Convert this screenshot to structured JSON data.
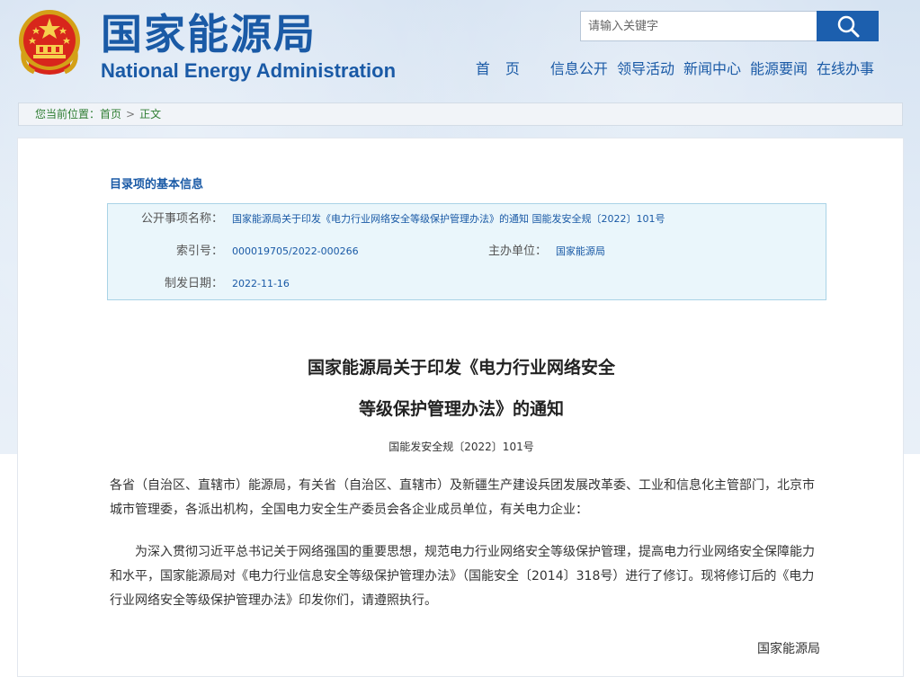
{
  "header": {
    "title_cn": "国家能源局",
    "title_en": "National Energy Administration",
    "search_placeholder": "请输入关键字",
    "emblem": "national-emblem"
  },
  "nav": {
    "items": [
      {
        "label": "首 页"
      },
      {
        "label": "信息公开"
      },
      {
        "label": "领导活动"
      },
      {
        "label": "新闻中心"
      },
      {
        "label": "能源要闻"
      },
      {
        "label": "在线办事"
      }
    ]
  },
  "breadcrumb": {
    "prefix": "您当前位置：",
    "home": "首页",
    "current": "正文"
  },
  "meta": {
    "heading": "目录项的基本信息",
    "title_label": "公开事项名称：",
    "title_value": "国家能源局关于印发《电力行业网络安全等级保护管理办法》的通知 国能发安全规〔2022〕101号",
    "index_label": "索引号：",
    "index_value": "000019705/2022-000266",
    "org_label": "主办单位：",
    "org_value": "国家能源局",
    "date_label": "制发日期：",
    "date_value": "2022-11-16"
  },
  "document": {
    "title_line1": "国家能源局关于印发《电力行业网络安全",
    "title_line2": "等级保护管理办法》的通知",
    "number": "国能发安全规〔2022〕101号",
    "para1": "各省（自治区、直辖市）能源局，有关省（自治区、直辖市）及新疆生产建设兵团发展改革委、工业和信息化主管部门，北京市城市管理委，各派出机构，全国电力安全生产委员会各企业成员单位，有关电力企业：",
    "para2": "为深入贯彻习近平总书记关于网络强国的重要思想，规范电力行业网络安全等级保护管理，提高电力行业网络安全保障能力和水平，国家能源局对《电力行业信息安全等级保护管理办法》（国能安全〔2014〕318号）进行了修订。现将修订后的《电力行业网络安全等级保护管理办法》印发你们，请遵照执行。",
    "signature": "国家能源局"
  },
  "colors": {
    "brand_blue": "#1a5aa6",
    "breadcrumb_green": "#2e7d32",
    "meta_bg": "#eaf6fb"
  }
}
